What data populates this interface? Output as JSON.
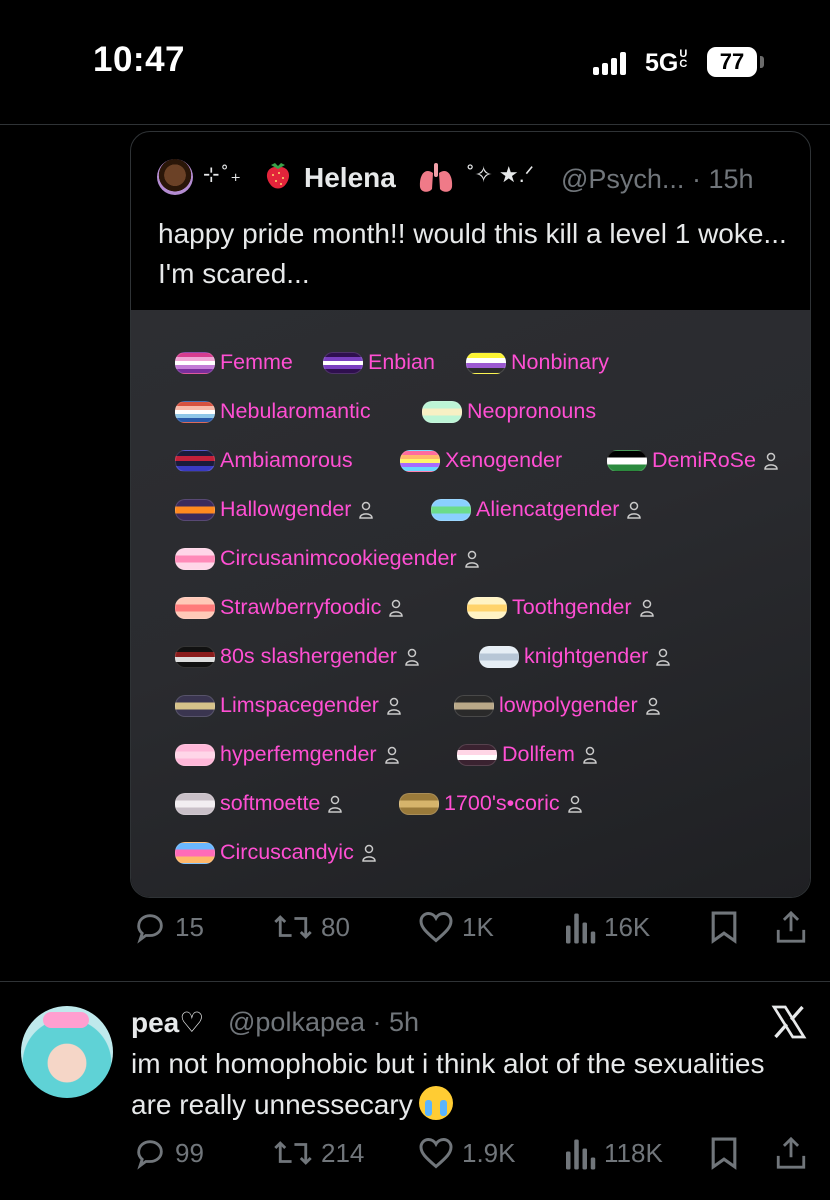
{
  "status_bar": {
    "time": "10:47",
    "network": "5G",
    "network_sub": "UC",
    "battery": "77"
  },
  "quoted_tweet": {
    "display_name": "Helena",
    "name_decorations_left": "⊹˚₊",
    "name_decorations_right": "˚✧ ★.ᐟ",
    "handle": "@Psych...",
    "time": "15h",
    "text": "happy pride month!! would this kill a level 1 woke... I'm scared...",
    "tags": [
      {
        "label": "Femme",
        "flag_colors": [
          "#d63c8f",
          "#f0a6d6",
          "#ffffff",
          "#c37bd6",
          "#7a2e9c"
        ],
        "user_icon": false
      },
      {
        "label": "Enbian",
        "flag_colors": [
          "#2f0f4f",
          "#7a3fc0",
          "#ffffff",
          "#7a3fc0",
          "#2f0f4f"
        ],
        "user_icon": false
      },
      {
        "label": "Nonbinary",
        "flag_colors": [
          "#fcf434",
          "#ffffff",
          "#9c59d1",
          "#2c2c2c"
        ],
        "user_icon": false
      },
      {
        "label": "Nebularomantic",
        "flag_colors": [
          "#d6513f",
          "#f7b9a9",
          "#ffffff",
          "#8fc7e8",
          "#2a5aa8"
        ],
        "user_icon": false
      },
      {
        "label": "Neopronouns",
        "flag_colors": [
          "#bdf5d6",
          "#f7f0c4",
          "#bdf5d6"
        ],
        "user_icon": false
      },
      {
        "label": "Ambiamorous",
        "flag_colors": [
          "#1b1b3a",
          "#c2203a",
          "#1b1b3a",
          "#3a3ac2"
        ],
        "user_icon": false
      },
      {
        "label": "Xenogender",
        "flag_colors": [
          "#ff6b9e",
          "#ffb86b",
          "#fff56b",
          "#a66bff",
          "#6bd6ff"
        ],
        "user_icon": false
      },
      {
        "label": "DemiRoSe",
        "flag_colors": [
          "#000000",
          "#ffffff",
          "#2b8a3e"
        ],
        "user_icon": true
      },
      {
        "label": "Hallowgender",
        "flag_colors": [
          "#3b2a5c",
          "#ff8a1f",
          "#3b2a5c"
        ],
        "user_icon": true
      },
      {
        "label": "Aliencatgender",
        "flag_colors": [
          "#8ad0ff",
          "#6bdc8a",
          "#8ad0ff"
        ],
        "user_icon": true
      },
      {
        "label": "Circusanimcookiegender",
        "flag_colors": [
          "#ffd6e8",
          "#ff8ab8",
          "#ffd6e8"
        ],
        "user_icon": true
      },
      {
        "label": "Strawberryfoodic",
        "flag_colors": [
          "#ffc9b8",
          "#ff7a7a",
          "#ffc9b8"
        ],
        "user_icon": true
      },
      {
        "label": "Toothgender",
        "flag_colors": [
          "#fff3c4",
          "#ffd36b",
          "#fff3c4"
        ],
        "user_icon": true
      },
      {
        "label": "80s slashergender",
        "flag_colors": [
          "#111111",
          "#8a1c1c",
          "#dddddd",
          "#111111"
        ],
        "user_icon": true
      },
      {
        "label": "knightgender",
        "flag_colors": [
          "#e6eef5",
          "#b7c6d6",
          "#e6eef5"
        ],
        "user_icon": true
      },
      {
        "label": "Limspacegender",
        "flag_colors": [
          "#3a3550",
          "#d6c28a",
          "#3a3550"
        ],
        "user_icon": true
      },
      {
        "label": "lowpolygender",
        "flag_colors": [
          "#2a2a2a",
          "#b9a888",
          "#2a2a2a"
        ],
        "user_icon": true
      },
      {
        "label": "hyperfemgender",
        "flag_colors": [
          "#ffb8d9",
          "#ffd6e8",
          "#ffb8d9"
        ],
        "user_icon": true
      },
      {
        "label": "Dollfem",
        "flag_colors": [
          "#3a2230",
          "#ffd6e6",
          "#ffffff",
          "#3a2230"
        ],
        "user_icon": true
      },
      {
        "label": "softmoette",
        "flag_colors": [
          "#c9c0c8",
          "#f2eef1",
          "#c9c0c8"
        ],
        "user_icon": true
      },
      {
        "label": "1700's•coric",
        "flag_colors": [
          "#9a7a3a",
          "#d6b46b",
          "#9a7a3a"
        ],
        "user_icon": true
      },
      {
        "label": "Circuscandyic",
        "flag_colors": [
          "#6bb8ff",
          "#ff6bb8",
          "#ffb86b"
        ],
        "user_icon": true
      }
    ],
    "tag_color": "#ff4fd3"
  },
  "quoted_actions": {
    "replies": "15",
    "reposts": "80",
    "likes": "1K",
    "views": "16K"
  },
  "reply_tweet": {
    "display_name": "pea♡",
    "handle": "@polkapea",
    "time": "5h",
    "text": "im not homophobic but i think alot of the sexualities are really unnessecary",
    "emoji": "loudly-crying-face"
  },
  "reply_actions": {
    "replies": "99",
    "reposts": "214",
    "likes": "1.9K",
    "views": "118K"
  },
  "colors": {
    "background": "#000000",
    "primary_text": "#e7e9ea",
    "secondary_text": "#71767b",
    "border": "#2f3336"
  }
}
